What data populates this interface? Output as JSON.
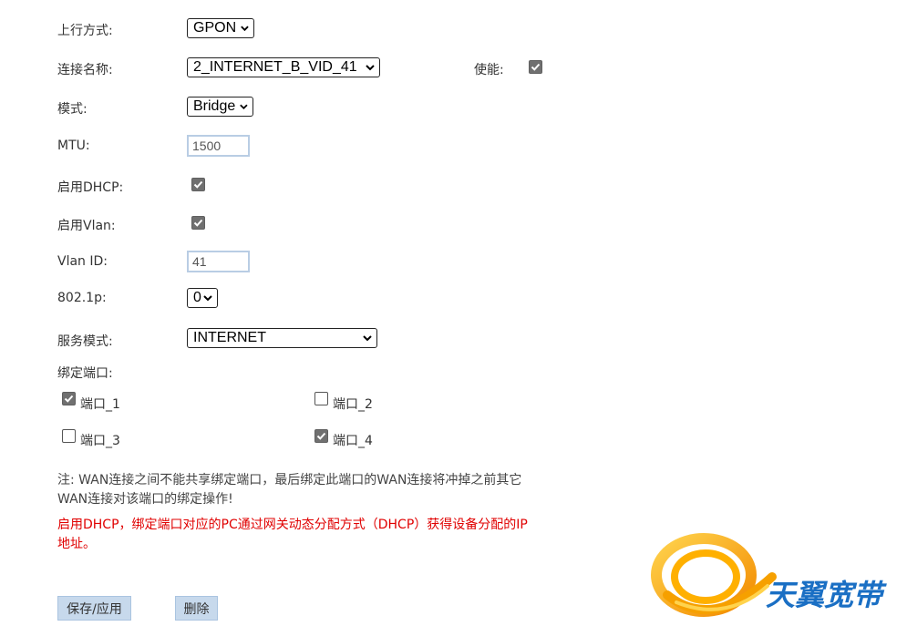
{
  "form": {
    "uplink_label": "上行方式:",
    "uplink_value": "GPON",
    "conn_name_label": "连接名称:",
    "conn_name_value": "2_INTERNET_B_VID_41",
    "enable_label": "使能:",
    "enable_checked": true,
    "mode_label": "模式:",
    "mode_value": "Bridge",
    "mtu_label": "MTU:",
    "mtu_value": "1500",
    "dhcp_label": "启用DHCP:",
    "dhcp_checked": true,
    "vlan_label": "启用Vlan:",
    "vlan_checked": true,
    "vlan_id_label": "Vlan ID:",
    "vlan_id_value": "41",
    "dot1p_label": "802.1p:",
    "dot1p_value": "0",
    "service_label": "服务模式:",
    "service_value": "INTERNET",
    "bind_label": "绑定端口:"
  },
  "ports": [
    {
      "label": "端口_1",
      "checked": true
    },
    {
      "label": "端口_2",
      "checked": false
    },
    {
      "label": "端口_3",
      "checked": false
    },
    {
      "label": "端口_4",
      "checked": true
    }
  ],
  "note_line1": "注: WAN连接之间不能共享绑定端口，最后绑定此端口的WAN连接将冲掉之前其它",
  "note_line2": "WAN连接对该端口的绑定操作!",
  "warn_line1": "启用DHCP，绑定端口对应的PC通过网关动态分配方式（DHCP）获得设备分配的IP",
  "warn_line2": "地址。",
  "buttons": {
    "save": "保存/应用",
    "delete": "删除"
  },
  "logo": {
    "text": "天翼宽带",
    "color_primary": "#f5a000",
    "color_text": "#1a6fc4"
  },
  "colors": {
    "button_bg": "#c7d9ec",
    "warn_text": "#e00000",
    "checkbox_checked": "#707070"
  }
}
